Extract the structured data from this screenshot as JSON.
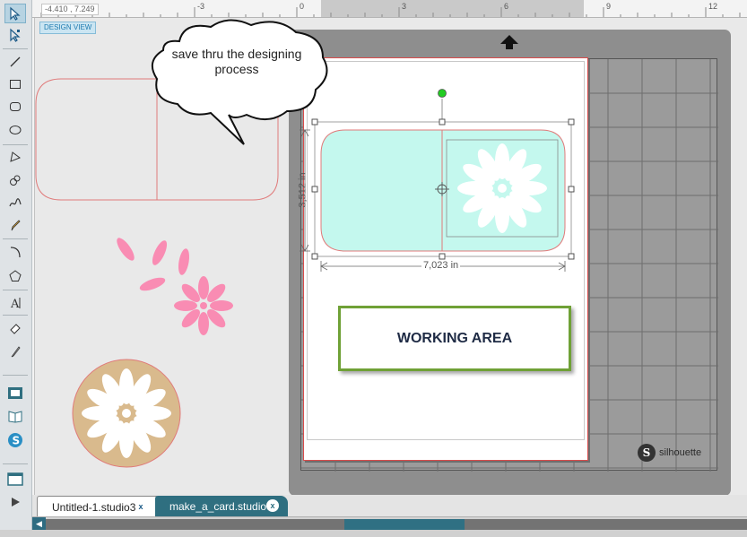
{
  "ruler": {
    "coords": "-4.410 , 7.249",
    "ticks": [
      "-3",
      "0",
      "3",
      "6",
      "9",
      "12"
    ]
  },
  "view_label": "DESIGN VIEW",
  "callout": "save thru the designing process",
  "dimensions": {
    "width": "7,023 in",
    "height": "3,512 in"
  },
  "working_area_label": "WORKING AREA",
  "brand": {
    "mark": "S",
    "name": "silhouette"
  },
  "tabs": [
    {
      "label": "Untitled-1.studio3",
      "close": "x",
      "active": true
    },
    {
      "label": "make_a_card.studio3",
      "close": "x",
      "active": false
    }
  ],
  "scroll_left_glyph": "◀",
  "colors": {
    "accent_teal": "#2f6f80",
    "card_fill": "#c4f8ee",
    "petal_pink": "#f98cb3",
    "tan_circle": "#d9ba8d",
    "cut_line": "#e07a7a",
    "highlight_green": "#6fa136"
  },
  "tools": [
    "select-arrow-icon",
    "node-edit-icon",
    "line-tool-icon",
    "rectangle-tool-icon",
    "rounded-rectangle-tool-icon",
    "ellipse-tool-icon",
    "polygon-tool-icon",
    "curve-tool-icon",
    "freehand-tool-icon",
    "pencil-tool-icon",
    "arc-tool-icon",
    "regular-polygon-tool-icon",
    "text-tool-icon",
    "eraser-tool-icon",
    "knife-tool-icon",
    "design-page-icon",
    "library-icon",
    "silhouette-store-icon",
    "panel-window-icon",
    "send-play-icon"
  ]
}
